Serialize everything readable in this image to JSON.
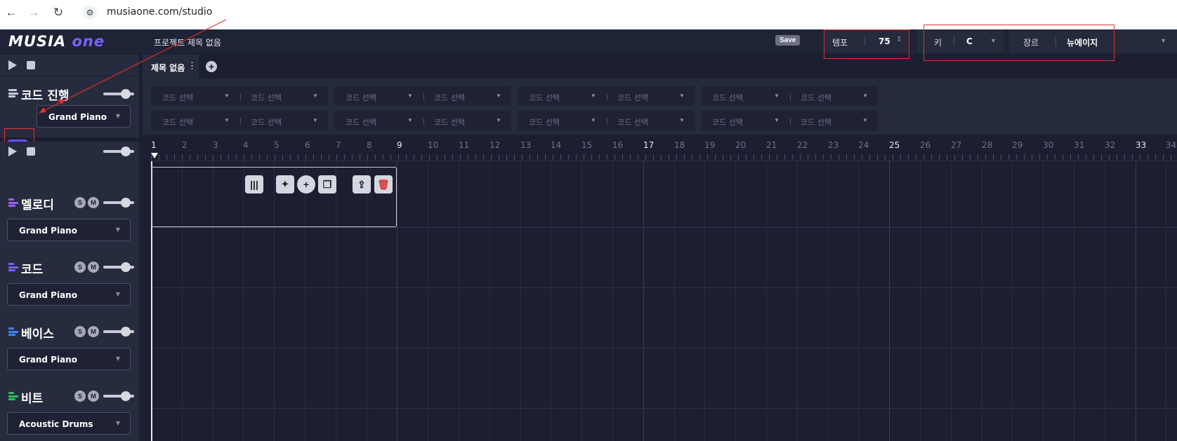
{
  "browser": {
    "url": "musiaone.com/studio",
    "back_icon": "←",
    "forward_icon": "→",
    "reload_icon": "↻",
    "site_info_icon": "⚙"
  },
  "app": {
    "logo_main": "MUSIA",
    "logo_accent": "one",
    "project_title": "프로젝트 제목 없음",
    "save_label": "Save",
    "tempo": {
      "label": "템포",
      "value": "75"
    },
    "key": {
      "label": "키",
      "value": "C"
    },
    "genre": {
      "label": "장르",
      "value": "뉴에이지"
    },
    "accent_color": "#6a4dfb"
  },
  "tabs": [
    {
      "label": "제목 없음"
    }
  ],
  "chord_section": {
    "title": "코드 진행",
    "instrument": "Grand Piano",
    "slot_label": "코드 선택",
    "rows": 2,
    "groups_per_row": 4
  },
  "tracks": [
    {
      "name": "멜로디",
      "solo": "S",
      "mute": "M",
      "instrument": "Grand Piano",
      "color": "#9b5cf0"
    },
    {
      "name": "코드",
      "solo": "S",
      "mute": "M",
      "instrument": "Grand Piano",
      "color": "#7a62ff"
    },
    {
      "name": "베이스",
      "solo": "S",
      "mute": "M",
      "instrument": "Grand Piano",
      "color": "#3b82f6"
    },
    {
      "name": "비트",
      "solo": "S",
      "mute": "M",
      "instrument": "Acoustic Drums",
      "color": "#22c55e"
    }
  ],
  "ruler": {
    "bars": [
      "1",
      "2",
      "3",
      "4",
      "5",
      "6",
      "7",
      "8",
      "9",
      "10",
      "11",
      "12",
      "13",
      "14",
      "15",
      "16",
      "17",
      "18",
      "19",
      "20",
      "21",
      "22",
      "23",
      "24",
      "25",
      "26",
      "27",
      "28",
      "29",
      "30",
      "31",
      "32",
      "33",
      "34"
    ],
    "major": [
      "1",
      "9",
      "17",
      "25",
      "33"
    ]
  },
  "clip_tools": [
    "piano-roll",
    "ai-generate",
    "add",
    "duplicate",
    "export",
    "delete"
  ]
}
